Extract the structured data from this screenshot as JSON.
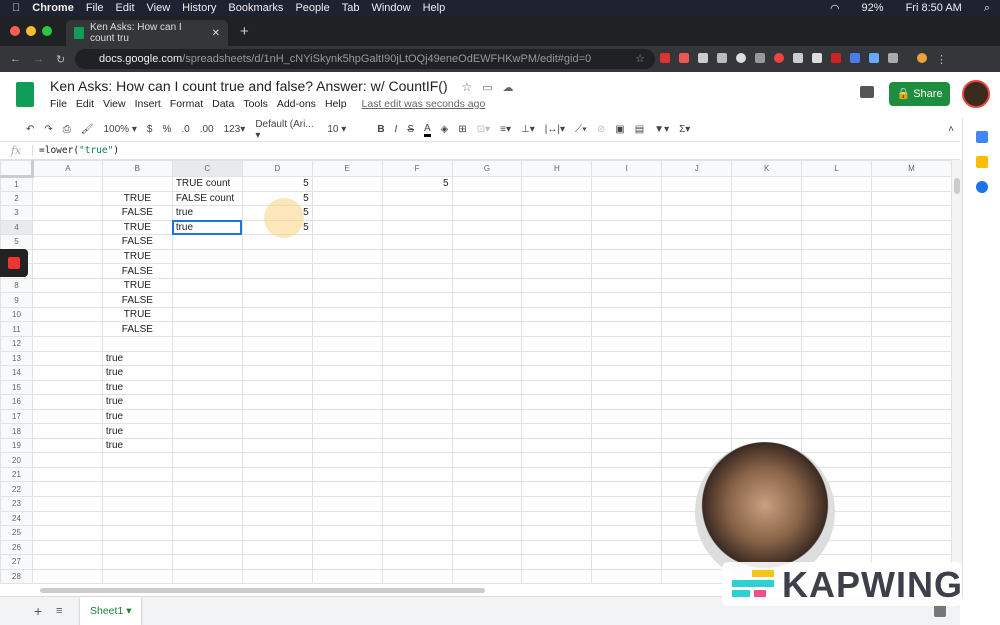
{
  "macbar": {
    "app": "Chrome",
    "menus": [
      "File",
      "Edit",
      "View",
      "History",
      "Bookmarks",
      "People",
      "Tab",
      "Window",
      "Help"
    ],
    "battery": "92%",
    "clock": "Fri 8:50 AM"
  },
  "browser": {
    "tab_title": "Ken Asks: How can I count tru",
    "url_domain": "docs.google.com",
    "url_path": "/spreadsheets/d/1nH_cNYiSkynk5hpGaltI90jLtOQj49eneOdEWFHKwPM/edit#gid=0"
  },
  "doc": {
    "title": "Ken Asks: How can I count true and false? Answer: w/ CountIF()",
    "menus": [
      "File",
      "Edit",
      "View",
      "Insert",
      "Format",
      "Data",
      "Tools",
      "Add-ons",
      "Help"
    ],
    "last_edit": "Last edit was seconds ago",
    "share_label": "Share"
  },
  "toolbar": {
    "zoom": "100%",
    "currency": "$",
    "percent": "%",
    "dec_less": ".0",
    "dec_more": ".00",
    "format": "123",
    "font": "Default (Ari...",
    "size": "10",
    "bold": "B",
    "italic": "I",
    "strike": "S",
    "text_color": "A",
    "sigma": "Σ"
  },
  "formula": {
    "fn": "=lower(",
    "arg": "\"true\"",
    "close": ")"
  },
  "grid": {
    "columns": [
      "A",
      "B",
      "C",
      "D",
      "E",
      "F",
      "G",
      "H",
      "I",
      "J",
      "K",
      "L",
      "M"
    ],
    "row_count": 28,
    "active_cell": "C4",
    "cells": {
      "C1": "TRUE count",
      "D1": "5",
      "F1": "5",
      "B2": "TRUE",
      "C2": "FALSE count",
      "D2": "5",
      "B3": "FALSE",
      "C3": "true",
      "D3": "5",
      "B4": "TRUE",
      "C4": "true",
      "D4": "5",
      "B5": "FALSE",
      "B6": "TRUE",
      "B7": "FALSE",
      "B8": "TRUE",
      "B9": "FALSE",
      "B10": "TRUE",
      "B11": "FALSE",
      "B13": "true",
      "B14": "true",
      "B15": "true",
      "B16": "true",
      "B17": "true",
      "B18": "true",
      "B19": "true"
    }
  },
  "sheets": [
    {
      "name": "Sheet1"
    }
  ],
  "watermark": {
    "text": "KAPWING"
  },
  "colors": {
    "accent": "#1a73e8",
    "share": "#1e8e3e",
    "sheets_green": "#0f9d58"
  }
}
